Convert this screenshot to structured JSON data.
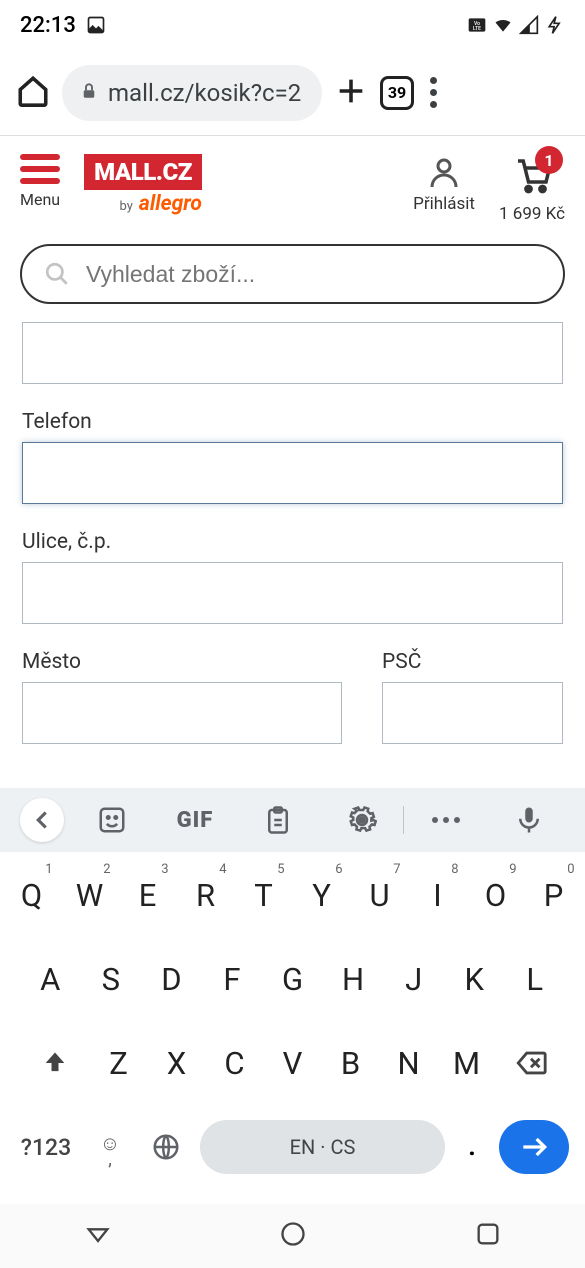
{
  "status": {
    "time": "22:13"
  },
  "browser": {
    "url": "mall.cz/kosik?c=2",
    "tab_count": "39"
  },
  "header": {
    "menu_label": "Menu",
    "logo_text": "MALL.CZ",
    "by_text": "by",
    "allegro_text": "allegro",
    "login_label": "Přihlásit",
    "cart_badge": "1",
    "cart_total": "1 699 Kč"
  },
  "search": {
    "placeholder": "Vyhledat zboží..."
  },
  "form": {
    "phone_label": "Telefon",
    "street_label": "Ulice, č.p.",
    "city_label": "Město",
    "zip_label": "PSČ"
  },
  "keyboard": {
    "gif": "GIF",
    "row1": [
      {
        "k": "Q",
        "s": "1"
      },
      {
        "k": "W",
        "s": "2"
      },
      {
        "k": "E",
        "s": "3"
      },
      {
        "k": "R",
        "s": "4"
      },
      {
        "k": "T",
        "s": "5"
      },
      {
        "k": "Y",
        "s": "6"
      },
      {
        "k": "U",
        "s": "7"
      },
      {
        "k": "I",
        "s": "8"
      },
      {
        "k": "O",
        "s": "9"
      },
      {
        "k": "P",
        "s": "0"
      }
    ],
    "row2": [
      "A",
      "S",
      "D",
      "F",
      "G",
      "H",
      "J",
      "K",
      "L"
    ],
    "row3": [
      "Z",
      "X",
      "C",
      "V",
      "B",
      "N",
      "M"
    ],
    "sym": "?123",
    "space": "EN · CS",
    "period": "."
  }
}
